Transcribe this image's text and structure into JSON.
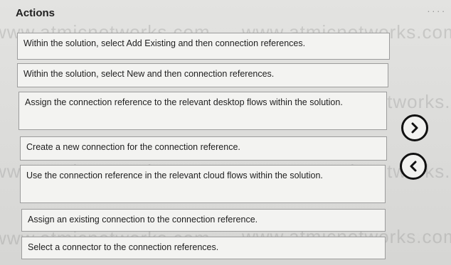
{
  "panel": {
    "title": "Actions",
    "dots": "....",
    "watermark": "www.atmicnetworks.com"
  },
  "actions": [
    {
      "label": "Within the solution, select Add Existing and then connection references."
    },
    {
      "label": "Within the solution, select New and then connection references."
    },
    {
      "label": "Assign the connection reference to the relevant desktop flows within the solution."
    },
    {
      "label": "Create a new connection for the connection reference."
    },
    {
      "label": "Use the connection reference in the relevant cloud flows within the solution."
    },
    {
      "label": "Assign an existing connection to the connection reference."
    },
    {
      "label": "Select a connector to the connection references."
    }
  ],
  "buttons": {
    "move_right_icon": "chevron-right-icon",
    "move_left_icon": "chevron-left-icon"
  }
}
